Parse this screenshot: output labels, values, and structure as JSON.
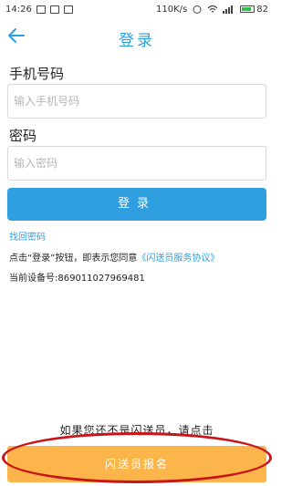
{
  "status_bar": {
    "time": "14:26",
    "speed": "110K/s",
    "battery": "82",
    "battery_level": 0.82
  },
  "nav": {
    "back_icon": "arrow-left-icon",
    "title": "登录"
  },
  "phone": {
    "label": "手机号码",
    "placeholder": "输入手机号码",
    "value": ""
  },
  "password": {
    "label": "密码",
    "placeholder": "输入密码",
    "value": ""
  },
  "login_button": {
    "label": "登录"
  },
  "forgot_link": "找回密码",
  "agreement": {
    "prefix": "点击“登录”按钮，即表示您同意",
    "link": "《闪送员服务协议》"
  },
  "device": {
    "label": "当前设备号:",
    "value": "869011027969481"
  },
  "bottom_hint": "如果您还不是闪送员，请点击",
  "signup_button": {
    "label": "闪送员报名"
  },
  "colors": {
    "accent": "#2f9fe0",
    "signup": "#fbb54b",
    "annotation": "#c9141a"
  }
}
